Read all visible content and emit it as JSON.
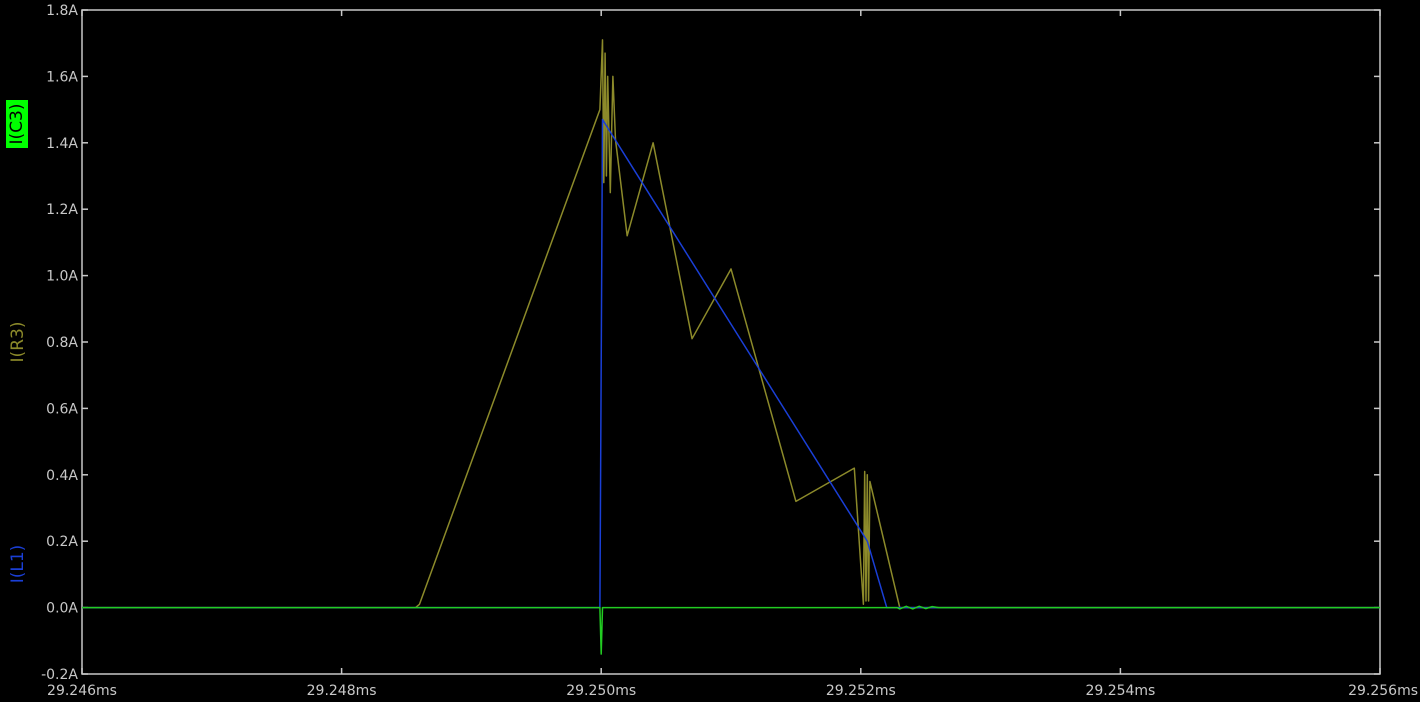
{
  "chart_data": {
    "type": "line",
    "xlim": [
      29.246,
      29.256
    ],
    "ylim": [
      -0.2,
      1.8
    ],
    "x_ticks": [
      29.246,
      29.248,
      29.25,
      29.252,
      29.254,
      29.256
    ],
    "x_tick_labels": [
      "29.246ms",
      "29.248ms",
      "29.250ms",
      "29.252ms",
      "29.254ms",
      "29.256ms"
    ],
    "y_ticks": [
      -0.2,
      0.0,
      0.2,
      0.4,
      0.6,
      0.8,
      1.0,
      1.2,
      1.4,
      1.6,
      1.8
    ],
    "y_tick_labels": [
      "-0.2A",
      "0.0A",
      "0.2A",
      "0.4A",
      "0.6A",
      "0.8A",
      "1.0A",
      "1.2A",
      "1.4A",
      "1.6A",
      "1.8A"
    ],
    "grid": false,
    "colors": {
      "background": "#000000",
      "axes": "#c8c8c8",
      "I(C3)": "#22cc22",
      "I(R3)": "#8c8a2a",
      "I(L1)": "#1a3fd6",
      "label_C3_bg": "#00ff00"
    },
    "series": [
      {
        "name": "I(C3)",
        "x": [
          29.246,
          29.24999,
          29.25,
          29.25001,
          29.2505,
          29.25228,
          29.2523,
          29.25235,
          29.2524,
          29.25245,
          29.2525,
          29.25255,
          29.2526,
          29.256
        ],
        "y": [
          0.0,
          0.0,
          -0.14,
          0.0,
          0.0,
          0.0,
          -0.004,
          0.004,
          -0.004,
          0.004,
          -0.003,
          0.003,
          0.0,
          0.0
        ]
      },
      {
        "name": "I(R3)",
        "x": [
          29.246,
          29.24857,
          29.2486,
          29.24999,
          29.25001,
          29.25002,
          29.25003,
          29.25004,
          29.25005,
          29.25007,
          29.25009,
          29.25011,
          29.2502,
          29.2504,
          29.2507,
          29.251,
          29.2515,
          29.25195,
          29.25202,
          29.25203,
          29.25204,
          29.25205,
          29.25206,
          29.25207,
          29.2523,
          29.256
        ],
        "y": [
          0.0,
          0.0,
          0.01,
          1.5,
          1.71,
          1.28,
          1.67,
          1.3,
          1.6,
          1.25,
          1.6,
          1.41,
          1.12,
          1.4,
          0.81,
          1.02,
          0.32,
          0.42,
          0.01,
          0.41,
          0.02,
          0.4,
          0.02,
          0.38,
          0.0,
          0.0
        ]
      },
      {
        "name": "I(L1)",
        "x": [
          29.246,
          29.24999,
          29.25001,
          29.25205,
          29.2522,
          29.256
        ],
        "y": [
          0.0,
          0.0,
          1.47,
          0.2,
          0.0,
          0.0
        ]
      }
    ]
  }
}
